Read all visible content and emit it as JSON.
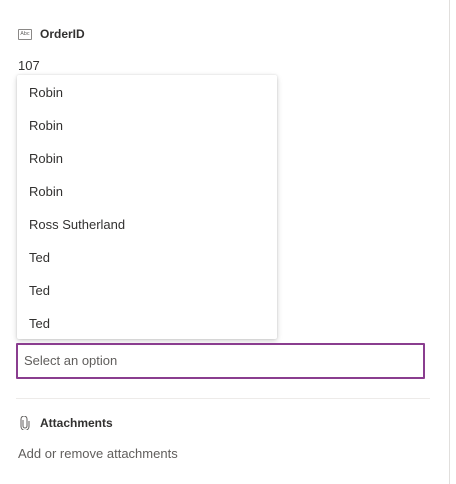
{
  "field": {
    "icon": "text-abc-icon",
    "icon_text": "Abc",
    "label": "OrderID",
    "value": "107"
  },
  "dropdown": {
    "options": [
      "Robin",
      "Robin",
      "Robin",
      "Robin",
      "Ross Sutherland",
      "Ted",
      "Ted",
      "Ted"
    ],
    "placeholder": "Select an option",
    "border_color": "#8a3d8f"
  },
  "attachments": {
    "icon": "paperclip-icon",
    "label": "Attachments",
    "link_text": "Add or remove attachments"
  }
}
